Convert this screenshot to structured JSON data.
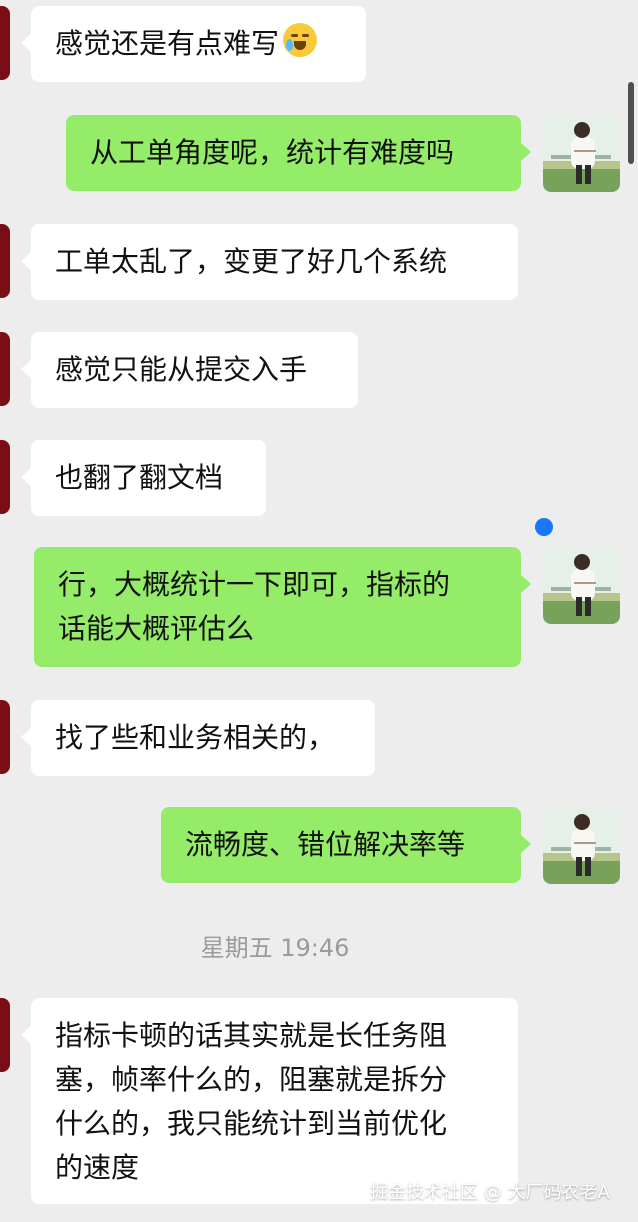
{
  "chat": {
    "messages": [
      {
        "text": "感觉还是有点难写"
      },
      {
        "text": "从工单角度呢，统计有难度吗"
      },
      {
        "text": "工单太乱了，变更了好几个系统"
      },
      {
        "text": "感觉只能从提交入手"
      },
      {
        "text": "也翻了翻文档"
      },
      {
        "line1": "行，大概统计一下即可，指标的",
        "line2": "话能大概评估么"
      },
      {
        "text": "找了些和业务相关的，"
      },
      {
        "text": "流畅度、错位解决率等"
      },
      {
        "line1": "指标卡顿的话其实就是长任务阻",
        "line2": "塞，帧率什么的，阻塞就是拆分",
        "line3": "什么的，我只能统计到当前优化",
        "line4": "的速度"
      }
    ],
    "timestamp": "星期五 19:46",
    "watermark": "掘金技术社区 @ 大厂码农老A"
  },
  "icons": {
    "emoji": "crying-laughing-emoji-icon",
    "status_dot": "unread-dot-icon"
  },
  "colors": {
    "background": "#ededed",
    "incoming_bubble": "#ffffff",
    "outgoing_bubble": "#95ec69",
    "timestamp": "#9b9b9b",
    "unread_dot": "#1677ff"
  }
}
